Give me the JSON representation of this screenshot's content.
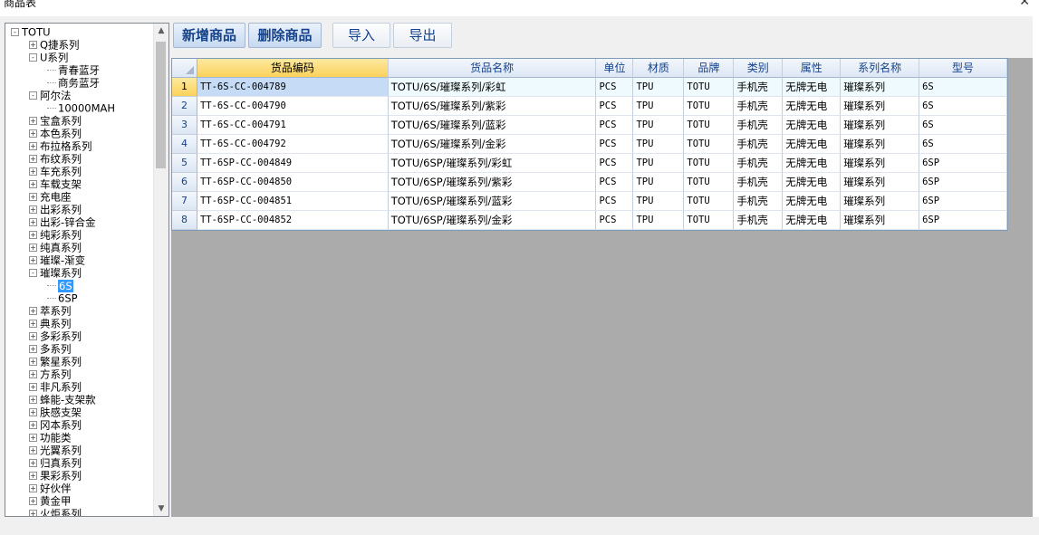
{
  "window": {
    "title": "商品表",
    "close_glyph": "✕"
  },
  "toolbar": {
    "add_label": "新增商品",
    "delete_label": "删除商品",
    "import_label": "导入",
    "export_label": "导出"
  },
  "tree": [
    {
      "label": "TOTU",
      "level": 0,
      "exp": "-"
    },
    {
      "label": "Q捷系列",
      "level": 1,
      "exp": "+"
    },
    {
      "label": "U系列",
      "level": 1,
      "exp": "-"
    },
    {
      "label": "青春蓝牙",
      "level": 2,
      "exp": ""
    },
    {
      "label": "商务蓝牙",
      "level": 2,
      "exp": ""
    },
    {
      "label": "阿尔法",
      "level": 1,
      "exp": "-"
    },
    {
      "label": "10000MAH",
      "level": 2,
      "exp": ""
    },
    {
      "label": "宝盒系列",
      "level": 1,
      "exp": "+"
    },
    {
      "label": "本色系列",
      "level": 1,
      "exp": "+"
    },
    {
      "label": "布拉格系列",
      "level": 1,
      "exp": "+"
    },
    {
      "label": "布纹系列",
      "level": 1,
      "exp": "+"
    },
    {
      "label": "车充系列",
      "level": 1,
      "exp": "+"
    },
    {
      "label": "车载支架",
      "level": 1,
      "exp": "+"
    },
    {
      "label": "充电座",
      "level": 1,
      "exp": "+"
    },
    {
      "label": "出彩系列",
      "level": 1,
      "exp": "+"
    },
    {
      "label": "出彩-锌合金",
      "level": 1,
      "exp": "+"
    },
    {
      "label": "纯彩系列",
      "level": 1,
      "exp": "+"
    },
    {
      "label": "纯真系列",
      "level": 1,
      "exp": "+"
    },
    {
      "label": "璀璨-渐变",
      "level": 1,
      "exp": "+"
    },
    {
      "label": "璀璨系列",
      "level": 1,
      "exp": "-"
    },
    {
      "label": "6S",
      "level": 2,
      "exp": "",
      "selected": true
    },
    {
      "label": "6SP",
      "level": 2,
      "exp": ""
    },
    {
      "label": "萃系列",
      "level": 1,
      "exp": "+"
    },
    {
      "label": "典系列",
      "level": 1,
      "exp": "+"
    },
    {
      "label": "多彩系列",
      "level": 1,
      "exp": "+"
    },
    {
      "label": "多系列",
      "level": 1,
      "exp": "+"
    },
    {
      "label": "繁星系列",
      "level": 1,
      "exp": "+"
    },
    {
      "label": "方系列",
      "level": 1,
      "exp": "+"
    },
    {
      "label": "非凡系列",
      "level": 1,
      "exp": "+"
    },
    {
      "label": "蜂能-支架款",
      "level": 1,
      "exp": "+"
    },
    {
      "label": "肤感支架",
      "level": 1,
      "exp": "+"
    },
    {
      "label": "冈本系列",
      "level": 1,
      "exp": "+"
    },
    {
      "label": "功能类",
      "level": 1,
      "exp": "+"
    },
    {
      "label": "光翼系列",
      "level": 1,
      "exp": "+"
    },
    {
      "label": "归真系列",
      "level": 1,
      "exp": "+"
    },
    {
      "label": "果彩系列",
      "level": 1,
      "exp": "+"
    },
    {
      "label": "好伙伴",
      "level": 1,
      "exp": "+"
    },
    {
      "label": "黄金甲",
      "level": 1,
      "exp": "+"
    },
    {
      "label": "火炬系列",
      "level": 1,
      "exp": "+"
    }
  ],
  "grid": {
    "columns": [
      "货品编码",
      "货品名称",
      "单位",
      "材质",
      "品牌",
      "类别",
      "属性",
      "系列名称",
      "型号"
    ],
    "rows": [
      {
        "num": "1",
        "cells": [
          "TT-6S-CC-004789",
          "TOTU/6S/璀璨系列/彩虹",
          "PCS",
          "TPU",
          "TOTU",
          "手机壳",
          "无牌无电",
          "璀璨系列",
          "6S"
        ]
      },
      {
        "num": "2",
        "cells": [
          "TT-6S-CC-004790",
          "TOTU/6S/璀璨系列/紫彩",
          "PCS",
          "TPU",
          "TOTU",
          "手机壳",
          "无牌无电",
          "璀璨系列",
          "6S"
        ]
      },
      {
        "num": "3",
        "cells": [
          "TT-6S-CC-004791",
          "TOTU/6S/璀璨系列/蓝彩",
          "PCS",
          "TPU",
          "TOTU",
          "手机壳",
          "无牌无电",
          "璀璨系列",
          "6S"
        ]
      },
      {
        "num": "4",
        "cells": [
          "TT-6S-CC-004792",
          "TOTU/6S/璀璨系列/金彩",
          "PCS",
          "TPU",
          "TOTU",
          "手机壳",
          "无牌无电",
          "璀璨系列",
          "6S"
        ]
      },
      {
        "num": "5",
        "cells": [
          "TT-6SP-CC-004849",
          "TOTU/6SP/璀璨系列/彩虹",
          "PCS",
          "TPU",
          "TOTU",
          "手机壳",
          "无牌无电",
          "璀璨系列",
          "6SP"
        ]
      },
      {
        "num": "6",
        "cells": [
          "TT-6SP-CC-004850",
          "TOTU/6SP/璀璨系列/紫彩",
          "PCS",
          "TPU",
          "TOTU",
          "手机壳",
          "无牌无电",
          "璀璨系列",
          "6SP"
        ]
      },
      {
        "num": "7",
        "cells": [
          "TT-6SP-CC-004851",
          "TOTU/6SP/璀璨系列/蓝彩",
          "PCS",
          "TPU",
          "TOTU",
          "手机壳",
          "无牌无电",
          "璀璨系列",
          "6SP"
        ]
      },
      {
        "num": "8",
        "cells": [
          "TT-6SP-CC-004852",
          "TOTU/6SP/璀璨系列/金彩",
          "PCS",
          "TPU",
          "TOTU",
          "手机壳",
          "无牌无电",
          "璀璨系列",
          "6SP"
        ]
      }
    ]
  },
  "colors": {
    "accent": "#15428b",
    "selection": "#3399ff",
    "header_active": "#fbd25b",
    "grid_bg": "#ababab"
  },
  "icons": {
    "close": "close-icon",
    "tree_expand": "plus-box-icon",
    "tree_collapse": "minus-box-icon",
    "scroll_up": "chevron-up-icon",
    "scroll_down": "chevron-down-icon"
  }
}
